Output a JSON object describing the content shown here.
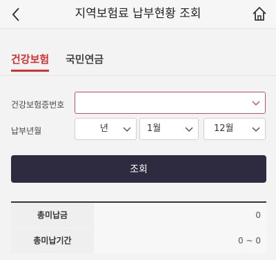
{
  "header": {
    "title": "지역보험료 납부현황 조회",
    "back_icon": "chevron-left-icon",
    "home_icon": "home-icon"
  },
  "tabs": [
    {
      "label": "건강보험",
      "active": true
    },
    {
      "label": "국민연금",
      "active": false
    }
  ],
  "form": {
    "insurance_number_label": "건강보험증번호",
    "insurance_number_value": "",
    "payment_month_label": "납부년월",
    "year_value": "년",
    "month_start_value": "1월",
    "month_end_value": "12월"
  },
  "submit_label": "조회",
  "summary": {
    "rows": [
      {
        "label": "총미납금",
        "value": "0"
      },
      {
        "label": "총미납기간",
        "value": "0 ~ 0"
      }
    ]
  },
  "colors": {
    "accent": "#d72f2f",
    "button_bg": "#2e2a3f",
    "input_border": "#c9525a"
  }
}
